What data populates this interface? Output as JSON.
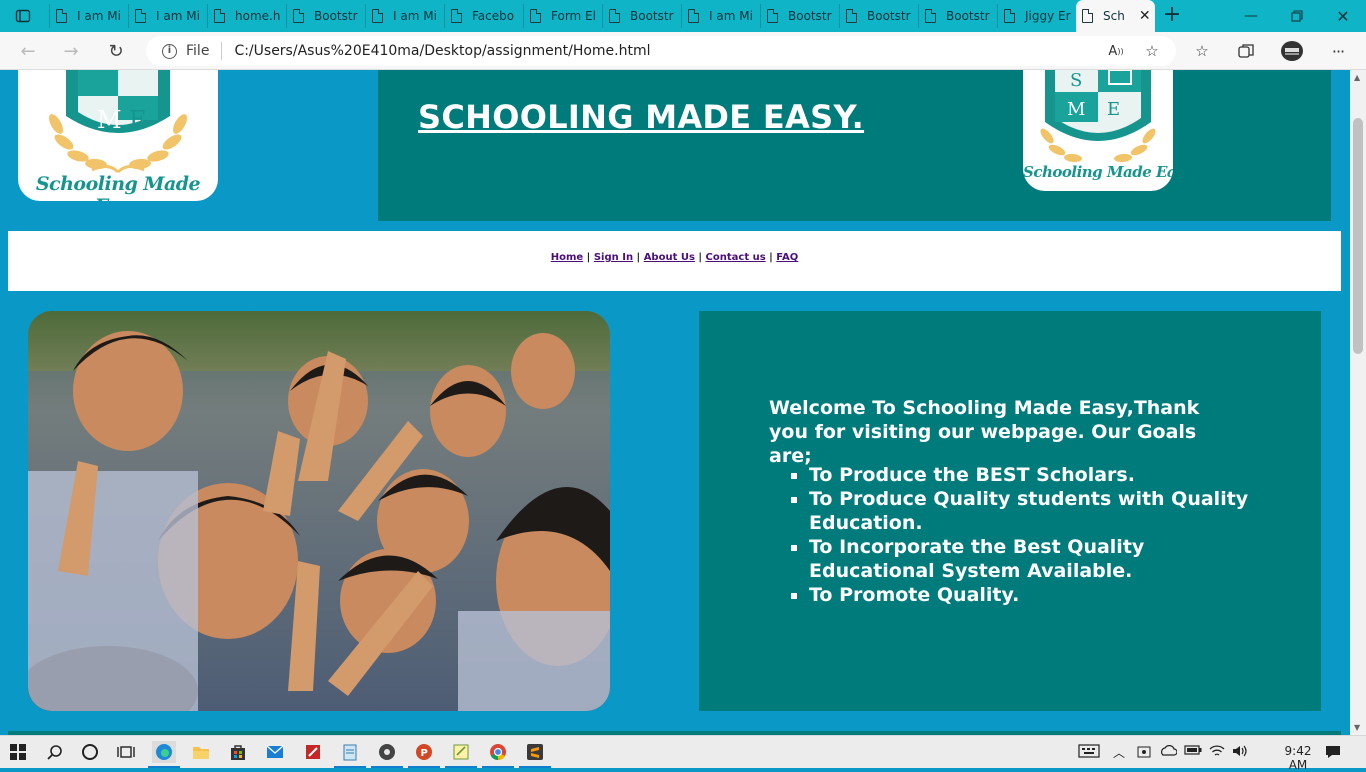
{
  "browser": {
    "tabs": [
      {
        "title": "I am Mi"
      },
      {
        "title": "I am Mi"
      },
      {
        "title": "home.h"
      },
      {
        "title": "Bootstr"
      },
      {
        "title": "I am Mi"
      },
      {
        "title": "Facebo"
      },
      {
        "title": "Form El"
      },
      {
        "title": "Bootstr"
      },
      {
        "title": "I am Mi"
      },
      {
        "title": "Bootstr"
      },
      {
        "title": "Bootstr"
      },
      {
        "title": "Bootstr"
      },
      {
        "title": "Jiggy Er"
      },
      {
        "title": "Sch",
        "active": true
      }
    ],
    "new_tab": "+",
    "address": {
      "scheme_label": "File",
      "url": "C:/Users/Asus%20E410ma/Desktop/assignment/Home.html"
    }
  },
  "page": {
    "logo_text": "Schooling Made Easy",
    "logo_letters": [
      "M",
      "E",
      "S"
    ],
    "banner_title": "SCHOOLING MADE EASY.",
    "nav": [
      "Home",
      "Sign In",
      "About Us",
      "Contact us",
      "FAQ"
    ],
    "welcome": "Welcome To Schooling Made Easy,Thank you for visiting our webpage. Our Goals are;",
    "goals": [
      "To Produce the BEST Scholars.",
      "To Produce Quality students with Quality Education.",
      "To Incorporate the Best Quality Educational System Available.",
      "To Promote Quality."
    ]
  },
  "colors": {
    "page_bg": "#0a98c6",
    "panel": "#007b7b",
    "tab_bar": "#0fb5c7",
    "nav_link": "#4a0f78",
    "logo_teal": "#16958f",
    "logo_gold": "#f1c46a"
  },
  "taskbar": {
    "clock": "9:42 AM"
  }
}
